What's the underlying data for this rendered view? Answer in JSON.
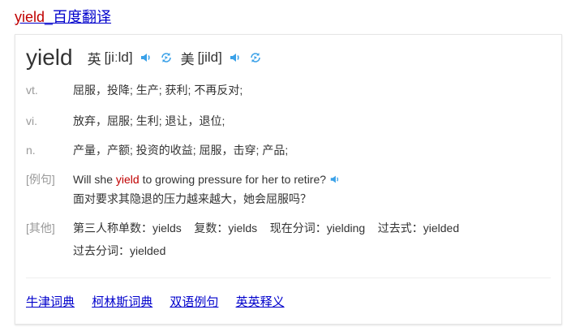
{
  "title": {
    "keyword": "yield",
    "suffix": "_百度翻译"
  },
  "entry": {
    "word": "yield",
    "uk_label": "英",
    "uk_phonetic": "[jiːld]",
    "us_label": "美",
    "us_phonetic": "[jild]"
  },
  "senses": [
    {
      "pos": "vt.",
      "def": "屈服，投降; 生产; 获利; 不再反对;"
    },
    {
      "pos": "vi.",
      "def": "放弃，屈服; 生利; 退让，退位;"
    },
    {
      "pos": "n.",
      "def": "产量，产额; 投资的收益; 屈服，击穿; 产品;"
    }
  ],
  "example": {
    "label": "[例句]",
    "en_before": "Will she ",
    "en_kw": "yield",
    "en_after": " to growing pressure for her to retire?",
    "zh": "面对要求其隐退的压力越来越大，她会屈服吗？"
  },
  "other": {
    "label": "[其他]",
    "line1": "第三人称单数：yields    复数：yields    现在分词：yielding    过去式：yielded",
    "line2": "过去分词：yielded"
  },
  "links": [
    "牛津词典",
    "柯林斯词典",
    "双语例句",
    "英英释义"
  ],
  "colors": {
    "link": "#0000cc",
    "keyword": "#c00000",
    "muted": "#999999",
    "icon": "#3aa1e8"
  }
}
